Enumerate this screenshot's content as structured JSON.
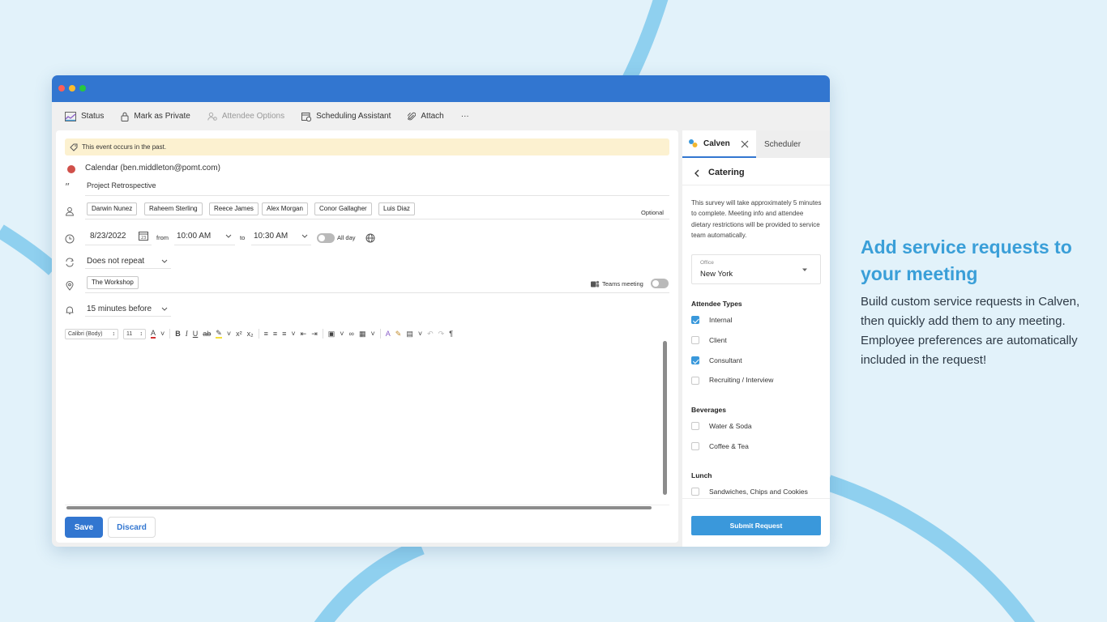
{
  "toolbar": {
    "status": "Status",
    "mark_private": "Mark as Private",
    "attendee_options": "Attendee Options",
    "scheduling_assistant": "Scheduling Assistant",
    "attach": "Attach",
    "more": "···"
  },
  "event": {
    "banner": "This event occurs in the past.",
    "calendar": "Calendar (ben.middleton@pomt.com)",
    "title": "Project Retrospective",
    "attendees": [
      "Darwin Nunez",
      "Raheem Sterling",
      "Reece James",
      "Alex Morgan",
      "Conor Gallagher",
      "Luis Diaz"
    ],
    "optional_label": "Optional",
    "date": "8/23/2022",
    "from_label": "from",
    "start_time": "10:00 AM",
    "to_label": "to",
    "end_time": "10:30 AM",
    "all_day_label": "All day",
    "repeat": "Does not repeat",
    "location": "The Workshop",
    "teams_label": "Teams meeting",
    "reminder": "15 minutes before"
  },
  "formatting": {
    "font": "Calibri (Body)",
    "size": "11"
  },
  "buttons": {
    "save": "Save",
    "discard": "Discard"
  },
  "panel": {
    "tab_active": "Calven",
    "tab_other": "Scheduler",
    "heading": "Catering",
    "intro": "This survey will take approximately 5 minutes to complete. Meeting info and attendee dietary restrictions will be provided to service team automatically.",
    "office_label": "Office",
    "office_value": "New York",
    "attendee_types_label": "Attendee Types",
    "attendee_types": [
      {
        "label": "Internal",
        "checked": true
      },
      {
        "label": "Client",
        "checked": false
      },
      {
        "label": "Consultant",
        "checked": true
      },
      {
        "label": "Recruiting / Interview",
        "checked": false
      }
    ],
    "beverages_label": "Beverages",
    "beverages": [
      {
        "label": "Water & Soda",
        "checked": false
      },
      {
        "label": "Coffee & Tea",
        "checked": false
      }
    ],
    "lunch_label": "Lunch",
    "lunch": [
      {
        "label": "Sandwiches, Chips and Cookies",
        "checked": false
      }
    ],
    "submit": "Submit Request"
  },
  "promo": {
    "title": "Add service requests to your meeting",
    "body": "Build custom service requests in Calven, then quickly add them to any meeting. Employee preferences are automatically included in the request!"
  },
  "colors": {
    "titlebar": "#3276d0",
    "accent": "#3a98db",
    "promo_title": "#3a9fd8",
    "background": "#e2f2fa",
    "arc": "#8fd0ef"
  }
}
